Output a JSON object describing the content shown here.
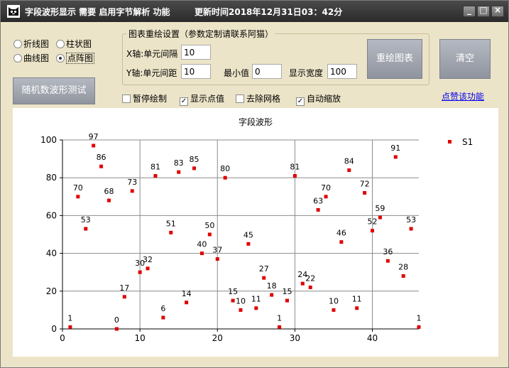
{
  "window": {
    "title": "字段波形显示 需要 启用字节解析 功能",
    "update_time": "更新时间2018年12月31日03：42分",
    "controls": {
      "minimize": "_",
      "maximize": "□",
      "close": "×"
    }
  },
  "chart_types": [
    {
      "label": "折线图",
      "selected": false
    },
    {
      "label": "柱状图",
      "selected": false
    },
    {
      "label": "曲线图",
      "selected": false
    },
    {
      "label": "点阵图",
      "selected": true
    }
  ],
  "random_test_button": "随机数波形测试",
  "settings": {
    "group_title": "图表重绘设置（参数定制请联系阿猫）",
    "x_interval_label": "X轴:单元间隔",
    "x_interval_value": "10",
    "y_interval_label": "Y轴:单元间距",
    "y_interval_value": "10",
    "min_label": "最小值",
    "min_value": "0",
    "width_label": "显示宽度",
    "width_value": "100"
  },
  "redraw_button": "重绘图表",
  "clear_button": "清空",
  "options": [
    {
      "label": "暂停绘制",
      "checked": false
    },
    {
      "label": "显示点值",
      "checked": true
    },
    {
      "label": "去除网格",
      "checked": false
    },
    {
      "label": "自动缩放",
      "checked": true
    }
  ],
  "support_link": "点赞该功能",
  "colors": {
    "series": "#e00000",
    "grid": "#8c8c8c"
  },
  "chart_data": {
    "type": "scatter",
    "title": "字段波形",
    "legend_position": "top-right",
    "xlim": [
      0,
      46
    ],
    "ylim": [
      0,
      100
    ],
    "x_ticks": [
      "0",
      "10",
      "20",
      "30",
      "40"
    ],
    "y_ticks": [
      "0",
      "20",
      "40",
      "60",
      "80",
      "100"
    ],
    "grid": true,
    "series": [
      {
        "name": "S1",
        "x": [
          1,
          2,
          3,
          4,
          5,
          6,
          7,
          8,
          9,
          10,
          11,
          12,
          13,
          14,
          15,
          16,
          17,
          18,
          19,
          20,
          21,
          22,
          23,
          24,
          25,
          26,
          27,
          28,
          29,
          30,
          31,
          32,
          33,
          34,
          35,
          36,
          37,
          38,
          39,
          40,
          41,
          42,
          43,
          44,
          45,
          46
        ],
        "y": [
          1,
          70,
          53,
          97,
          86,
          68,
          0,
          17,
          73,
          30,
          32,
          81,
          6,
          51,
          83,
          14,
          85,
          40,
          50,
          37,
          80,
          15,
          10,
          45,
          11,
          27,
          18,
          1,
          15,
          81,
          24,
          22,
          63,
          70,
          10,
          46,
          84,
          11,
          72,
          52,
          59,
          36,
          91,
          28,
          53,
          1
        ]
      }
    ]
  }
}
